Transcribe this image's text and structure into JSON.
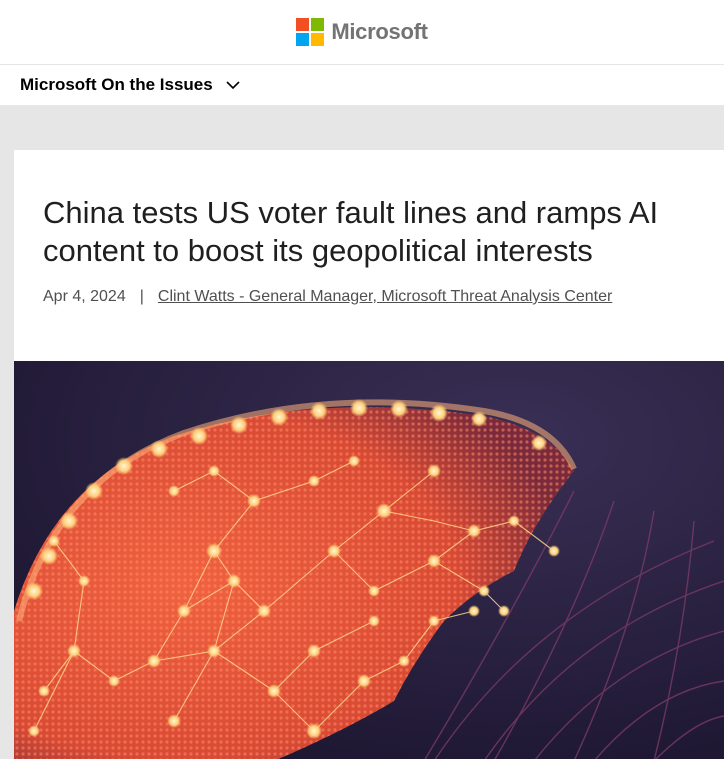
{
  "header": {
    "logo": {
      "icon": "microsoft-logo-icon",
      "colors": [
        "#f25022",
        "#7fba00",
        "#00a4ef",
        "#ffb900"
      ],
      "wordmark": "Microsoft"
    }
  },
  "subnav": {
    "title": "Microsoft On the Issues",
    "chevron_icon": "chevron-down-icon"
  },
  "article": {
    "headline": "China tests US voter fault lines and ramps AI content to boost its geopolitical interests",
    "date": "Apr 4, 2024",
    "separator": "|",
    "author": "Clint Watts - General Manager, Microsoft Threat Analysis Center"
  },
  "hero_image": {
    "icon": "glowing-globe-network-image",
    "colors": {
      "background": "#231c38",
      "land": "#e8523a",
      "glow": "#ffcf7a"
    }
  }
}
